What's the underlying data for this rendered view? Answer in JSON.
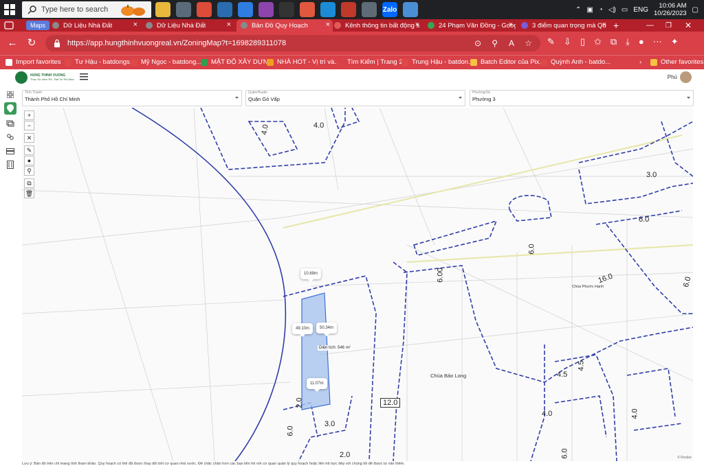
{
  "taskbar": {
    "search_placeholder": "Type here to search",
    "lang": "ENG",
    "time": "10:06 AM",
    "date": "10/26/2023",
    "apps": [
      {
        "name": "file-explorer-icon",
        "color": "#e8b73c",
        "label": ""
      },
      {
        "name": "clock-app-icon",
        "color": "#5b6b7b",
        "label": ""
      },
      {
        "name": "chrome-icon",
        "color": "#dd4b39",
        "label": ""
      },
      {
        "name": "calculator-app-icon",
        "color": "#2b6cb0",
        "label": ""
      },
      {
        "name": "todo-app-icon",
        "color": "#2f7de1",
        "label": ""
      },
      {
        "name": "app-icon-purple",
        "color": "#8e44ad",
        "label": ""
      },
      {
        "name": "media-player-icon",
        "color": "#333333",
        "label": ""
      },
      {
        "name": "app-icon-orange",
        "color": "#e2583e",
        "label": ""
      },
      {
        "name": "edge-icon",
        "color": "#1b8bd6",
        "label": ""
      },
      {
        "name": "app-icon-red",
        "color": "#c0392b",
        "label": ""
      },
      {
        "name": "calculator-icon",
        "color": "#5f6b76",
        "label": ""
      },
      {
        "name": "zalo-icon",
        "color": "#0068ff",
        "label": "Zalo"
      },
      {
        "name": "app-icon-blue",
        "color": "#4a8ed6",
        "label": ""
      }
    ]
  },
  "tabs": [
    {
      "label": "Maps",
      "type": "pill"
    },
    {
      "label": "Dữ Liệu Nhà Đất",
      "fav": "#8a8a8a"
    },
    {
      "label": "Dữ Liệu Nhà Đất",
      "fav": "#8a8a8a"
    },
    {
      "label": "Bản Đồ Quy Hoạch",
      "fav": "#8a8a8a",
      "active": true
    },
    {
      "label": "Kênh thông tin bất động s",
      "fav": "#e25b5b"
    },
    {
      "label": "24 Phạm Văn Đồng - Goog",
      "fav": "#34a853"
    },
    {
      "label": "3 điểm quan trọng mà Qu",
      "fav": "#7b5bd9"
    }
  ],
  "address": {
    "url": "https://app.hungthinhvuongreal.vn/ZoningMap?t=1698289311078"
  },
  "favorites": [
    {
      "label": "Import favorites",
      "color": "#ffffff"
    },
    {
      "label": "Tư Hậu - batdongs...",
      "color": "#e04848"
    },
    {
      "label": "Mỹ Ngọc - batdong...",
      "color": "#e04848"
    },
    {
      "label": "MẶT ĐỘ XÂY DỰN...",
      "color": "#2e9e4f"
    },
    {
      "label": "NHÀ HOT - Vị trí và...",
      "color": "#f0a020"
    },
    {
      "label": "Tìm Kiếm | Trang 2...",
      "color": "#d94048"
    },
    {
      "label": "Trung Hậu - batdon...",
      "color": "#e04848"
    },
    {
      "label": "Batch Editor của Pix...",
      "color": "#f5c242"
    },
    {
      "label": "Quỳnh Anh - batdo...",
      "color": "#e04848"
    },
    {
      "label": "Other favorites",
      "color": "#f5c242"
    }
  ],
  "app": {
    "brand_line1": "HUNG THINH VUONG",
    "brand_line2": "Thực Sự Nhìn Rõ - Bất Tin Rồi Mua",
    "user_name": "Phú"
  },
  "filters": [
    {
      "label": "Tỉnh Thành",
      "value": "Thành Phố Hồ Chí Minh"
    },
    {
      "label": "Quận/Huyện",
      "value": "Quận Gò Vấp"
    },
    {
      "label": "Phường/Xã",
      "value": "Phường 3"
    }
  ],
  "map_controls": [
    "+",
    "−",
    "✕",
    "✎",
    "●",
    "⚲",
    "⧉",
    "🗑"
  ],
  "map": {
    "callouts": [
      {
        "id": "top",
        "text": "10.69m"
      },
      {
        "id": "left",
        "text": "49.10m"
      },
      {
        "id": "right",
        "text": "50.34m"
      },
      {
        "id": "bottom",
        "text": "11.07m"
      }
    ],
    "area_label": "Diện tích: 546 m²",
    "places": [
      "Chùa Bảo Long",
      "Chùa Phước Hạnh"
    ],
    "road_widths": [
      "4.0",
      "4.0",
      "3.0",
      "6.0",
      "6.00",
      "6.0",
      "16.0",
      "6.0",
      "4.5",
      "4.5",
      "4.0",
      "4.0",
      "2.0",
      "6.0",
      "3.0",
      "2.0",
      "6.0"
    ],
    "road_box": "12.0",
    "attribution": "© Rocker"
  },
  "footer_note": "Lưu ý: Bản đồ trên chỉ mang tính tham khảo. Quy hoạch có thể đã được thay đổi bởi cơ quan nhà nước. Để chắc chắn hơn các bạn liên hệ với cơ quan quản lý quy hoạch hoặc liên hệ trực tiếp với chúng tôi để được tư vấn thêm."
}
